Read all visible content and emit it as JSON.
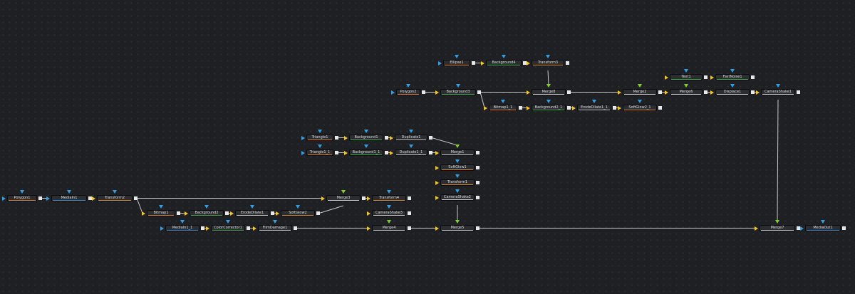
{
  "app": {
    "view": "Flow"
  },
  "colors": {
    "wire": "#c9c9c9",
    "background_input": "#f5c518",
    "foreground_input": "#7bd12a",
    "mask_input": "#2f9fe8",
    "output": "#e8e8e8",
    "stripe_generator": "#e07a2f",
    "stripe_background": "#3faa4a",
    "stripe_io": "#3a8bd6",
    "stripe_transform": "#d9892b",
    "stripe_effect": "#cccccc"
  },
  "nodes": [
    {
      "id": "ellipse1",
      "label": "Ellipse1",
      "stripe": "stripe_generator"
    },
    {
      "id": "background4",
      "label": "Background4",
      "stripe": "stripe_background"
    },
    {
      "id": "transform3",
      "label": "Transform3",
      "stripe": "stripe_transform"
    },
    {
      "id": "text1",
      "label": "Text1",
      "stripe": "stripe_background"
    },
    {
      "id": "fastnoise1",
      "label": "FastNoise1",
      "stripe": "stripe_background"
    },
    {
      "id": "polygon2",
      "label": "Polygon2",
      "stripe": "stripe_generator"
    },
    {
      "id": "background3",
      "label": "Background3",
      "stripe": "stripe_background"
    },
    {
      "id": "merge8",
      "label": "Merge8",
      "stripe": "stripe_effect"
    },
    {
      "id": "merge2",
      "label": "Merge2",
      "stripe": "stripe_effect"
    },
    {
      "id": "merge6",
      "label": "Merge6",
      "stripe": "stripe_effect"
    },
    {
      "id": "displace1",
      "label": "Displace1",
      "stripe": "stripe_effect"
    },
    {
      "id": "camerashake1",
      "label": "CameraShake1",
      "stripe": "stripe_effect"
    },
    {
      "id": "bitmap1_1",
      "label": "Bitmap1_1",
      "stripe": "stripe_generator"
    },
    {
      "id": "background2_1",
      "label": "Background2_1",
      "stripe": "stripe_background"
    },
    {
      "id": "erodedilate1_1",
      "label": "ErodeDilate1_1",
      "stripe": "stripe_effect"
    },
    {
      "id": "softglow2_1",
      "label": "SoftGlow2_1",
      "stripe": "stripe_transform"
    },
    {
      "id": "triangle1",
      "label": "Triangle1",
      "stripe": "stripe_generator"
    },
    {
      "id": "background1",
      "label": "Background1",
      "stripe": "stripe_background"
    },
    {
      "id": "duplicate1",
      "label": "Duplicate1",
      "stripe": "stripe_effect"
    },
    {
      "id": "triangle1_1",
      "label": "Triangle1_1",
      "stripe": "stripe_generator"
    },
    {
      "id": "background1_1",
      "label": "Background1_1",
      "stripe": "stripe_background"
    },
    {
      "id": "duplicate1_1",
      "label": "Duplicate1_1",
      "stripe": "stripe_effect"
    },
    {
      "id": "merge1",
      "label": "Merge1",
      "stripe": "stripe_effect"
    },
    {
      "id": "softglow1",
      "label": "SoftGlow1",
      "stripe": "stripe_transform"
    },
    {
      "id": "transform1",
      "label": "Transform1",
      "stripe": "stripe_transform"
    },
    {
      "id": "camerashake2",
      "label": "CameraShake2",
      "stripe": "stripe_effect"
    },
    {
      "id": "polygon1",
      "label": "Polygon1",
      "stripe": "stripe_generator"
    },
    {
      "id": "mediain1",
      "label": "MediaIn1",
      "stripe": "stripe_io"
    },
    {
      "id": "transform2",
      "label": "Transform2",
      "stripe": "stripe_transform"
    },
    {
      "id": "merge3",
      "label": "Merge3",
      "stripe": "stripe_effect"
    },
    {
      "id": "transform4",
      "label": "Transform4",
      "stripe": "stripe_transform"
    },
    {
      "id": "bitmap1",
      "label": "Bitmap1",
      "stripe": "stripe_generator"
    },
    {
      "id": "background2",
      "label": "Background2",
      "stripe": "stripe_background"
    },
    {
      "id": "erodedilate1",
      "label": "ErodeDilate1",
      "stripe": "stripe_effect"
    },
    {
      "id": "softglow2",
      "label": "SoftGlow2",
      "stripe": "stripe_transform"
    },
    {
      "id": "camerashake3",
      "label": "CameraShake3",
      "stripe": "stripe_effect"
    },
    {
      "id": "mediain1_1",
      "label": "MediaIn1_1",
      "stripe": "stripe_io"
    },
    {
      "id": "colorcorrector1",
      "label": "ColorCorrector1",
      "stripe": "stripe_background"
    },
    {
      "id": "filmdamage1",
      "label": "FilmDamage1",
      "stripe": "stripe_effect"
    },
    {
      "id": "merge4",
      "label": "Merge4",
      "stripe": "stripe_effect"
    },
    {
      "id": "merge5",
      "label": "Merge5",
      "stripe": "stripe_effect"
    },
    {
      "id": "merge7",
      "label": "Merge7",
      "stripe": "stripe_effect"
    },
    {
      "id": "mediaout1",
      "label": "MediaOut1",
      "stripe": "stripe_io"
    }
  ]
}
